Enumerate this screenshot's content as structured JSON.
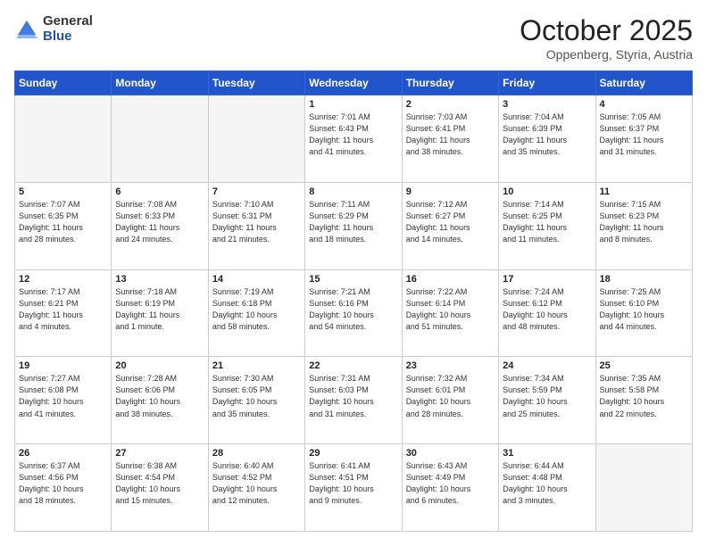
{
  "header": {
    "logo_general": "General",
    "logo_blue": "Blue",
    "month_title": "October 2025",
    "location": "Oppenberg, Styria, Austria"
  },
  "days_of_week": [
    "Sunday",
    "Monday",
    "Tuesday",
    "Wednesday",
    "Thursday",
    "Friday",
    "Saturday"
  ],
  "weeks": [
    [
      {
        "day": "",
        "info": ""
      },
      {
        "day": "",
        "info": ""
      },
      {
        "day": "",
        "info": ""
      },
      {
        "day": "1",
        "info": "Sunrise: 7:01 AM\nSunset: 6:43 PM\nDaylight: 11 hours\nand 41 minutes."
      },
      {
        "day": "2",
        "info": "Sunrise: 7:03 AM\nSunset: 6:41 PM\nDaylight: 11 hours\nand 38 minutes."
      },
      {
        "day": "3",
        "info": "Sunrise: 7:04 AM\nSunset: 6:39 PM\nDaylight: 11 hours\nand 35 minutes."
      },
      {
        "day": "4",
        "info": "Sunrise: 7:05 AM\nSunset: 6:37 PM\nDaylight: 11 hours\nand 31 minutes."
      }
    ],
    [
      {
        "day": "5",
        "info": "Sunrise: 7:07 AM\nSunset: 6:35 PM\nDaylight: 11 hours\nand 28 minutes."
      },
      {
        "day": "6",
        "info": "Sunrise: 7:08 AM\nSunset: 6:33 PM\nDaylight: 11 hours\nand 24 minutes."
      },
      {
        "day": "7",
        "info": "Sunrise: 7:10 AM\nSunset: 6:31 PM\nDaylight: 11 hours\nand 21 minutes."
      },
      {
        "day": "8",
        "info": "Sunrise: 7:11 AM\nSunset: 6:29 PM\nDaylight: 11 hours\nand 18 minutes."
      },
      {
        "day": "9",
        "info": "Sunrise: 7:12 AM\nSunset: 6:27 PM\nDaylight: 11 hours\nand 14 minutes."
      },
      {
        "day": "10",
        "info": "Sunrise: 7:14 AM\nSunset: 6:25 PM\nDaylight: 11 hours\nand 11 minutes."
      },
      {
        "day": "11",
        "info": "Sunrise: 7:15 AM\nSunset: 6:23 PM\nDaylight: 11 hours\nand 8 minutes."
      }
    ],
    [
      {
        "day": "12",
        "info": "Sunrise: 7:17 AM\nSunset: 6:21 PM\nDaylight: 11 hours\nand 4 minutes."
      },
      {
        "day": "13",
        "info": "Sunrise: 7:18 AM\nSunset: 6:19 PM\nDaylight: 11 hours\nand 1 minute."
      },
      {
        "day": "14",
        "info": "Sunrise: 7:19 AM\nSunset: 6:18 PM\nDaylight: 10 hours\nand 58 minutes."
      },
      {
        "day": "15",
        "info": "Sunrise: 7:21 AM\nSunset: 6:16 PM\nDaylight: 10 hours\nand 54 minutes."
      },
      {
        "day": "16",
        "info": "Sunrise: 7:22 AM\nSunset: 6:14 PM\nDaylight: 10 hours\nand 51 minutes."
      },
      {
        "day": "17",
        "info": "Sunrise: 7:24 AM\nSunset: 6:12 PM\nDaylight: 10 hours\nand 48 minutes."
      },
      {
        "day": "18",
        "info": "Sunrise: 7:25 AM\nSunset: 6:10 PM\nDaylight: 10 hours\nand 44 minutes."
      }
    ],
    [
      {
        "day": "19",
        "info": "Sunrise: 7:27 AM\nSunset: 6:08 PM\nDaylight: 10 hours\nand 41 minutes."
      },
      {
        "day": "20",
        "info": "Sunrise: 7:28 AM\nSunset: 6:06 PM\nDaylight: 10 hours\nand 38 minutes."
      },
      {
        "day": "21",
        "info": "Sunrise: 7:30 AM\nSunset: 6:05 PM\nDaylight: 10 hours\nand 35 minutes."
      },
      {
        "day": "22",
        "info": "Sunrise: 7:31 AM\nSunset: 6:03 PM\nDaylight: 10 hours\nand 31 minutes."
      },
      {
        "day": "23",
        "info": "Sunrise: 7:32 AM\nSunset: 6:01 PM\nDaylight: 10 hours\nand 28 minutes."
      },
      {
        "day": "24",
        "info": "Sunrise: 7:34 AM\nSunset: 5:59 PM\nDaylight: 10 hours\nand 25 minutes."
      },
      {
        "day": "25",
        "info": "Sunrise: 7:35 AM\nSunset: 5:58 PM\nDaylight: 10 hours\nand 22 minutes."
      }
    ],
    [
      {
        "day": "26",
        "info": "Sunrise: 6:37 AM\nSunset: 4:56 PM\nDaylight: 10 hours\nand 18 minutes."
      },
      {
        "day": "27",
        "info": "Sunrise: 6:38 AM\nSunset: 4:54 PM\nDaylight: 10 hours\nand 15 minutes."
      },
      {
        "day": "28",
        "info": "Sunrise: 6:40 AM\nSunset: 4:52 PM\nDaylight: 10 hours\nand 12 minutes."
      },
      {
        "day": "29",
        "info": "Sunrise: 6:41 AM\nSunset: 4:51 PM\nDaylight: 10 hours\nand 9 minutes."
      },
      {
        "day": "30",
        "info": "Sunrise: 6:43 AM\nSunset: 4:49 PM\nDaylight: 10 hours\nand 6 minutes."
      },
      {
        "day": "31",
        "info": "Sunrise: 6:44 AM\nSunset: 4:48 PM\nDaylight: 10 hours\nand 3 minutes."
      },
      {
        "day": "",
        "info": ""
      }
    ]
  ]
}
